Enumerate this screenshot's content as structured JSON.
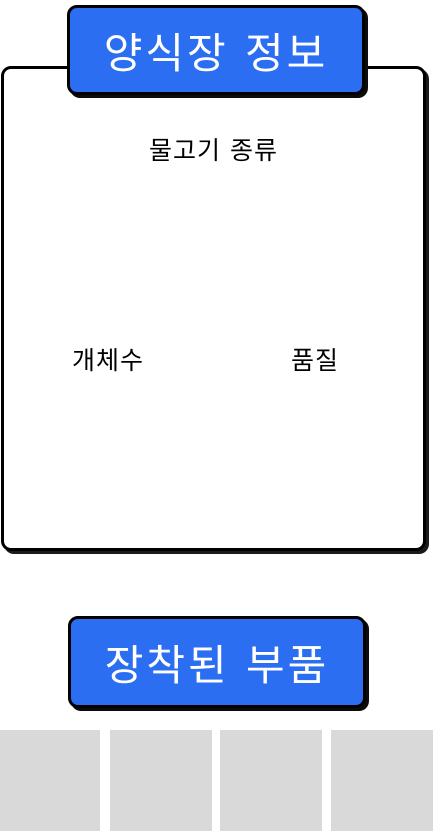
{
  "farm_info": {
    "title": "양식장 정보",
    "fish_type_label": "물고기 종류",
    "count_label": "개체수",
    "quality_label": "품질"
  },
  "equipped_parts": {
    "title": "장착된 부품",
    "slots": [
      "",
      "",
      "",
      ""
    ]
  },
  "colors": {
    "banner_blue": "#2b6ef2",
    "slot_gray": "#d9d9d9",
    "border_black": "#000000"
  }
}
